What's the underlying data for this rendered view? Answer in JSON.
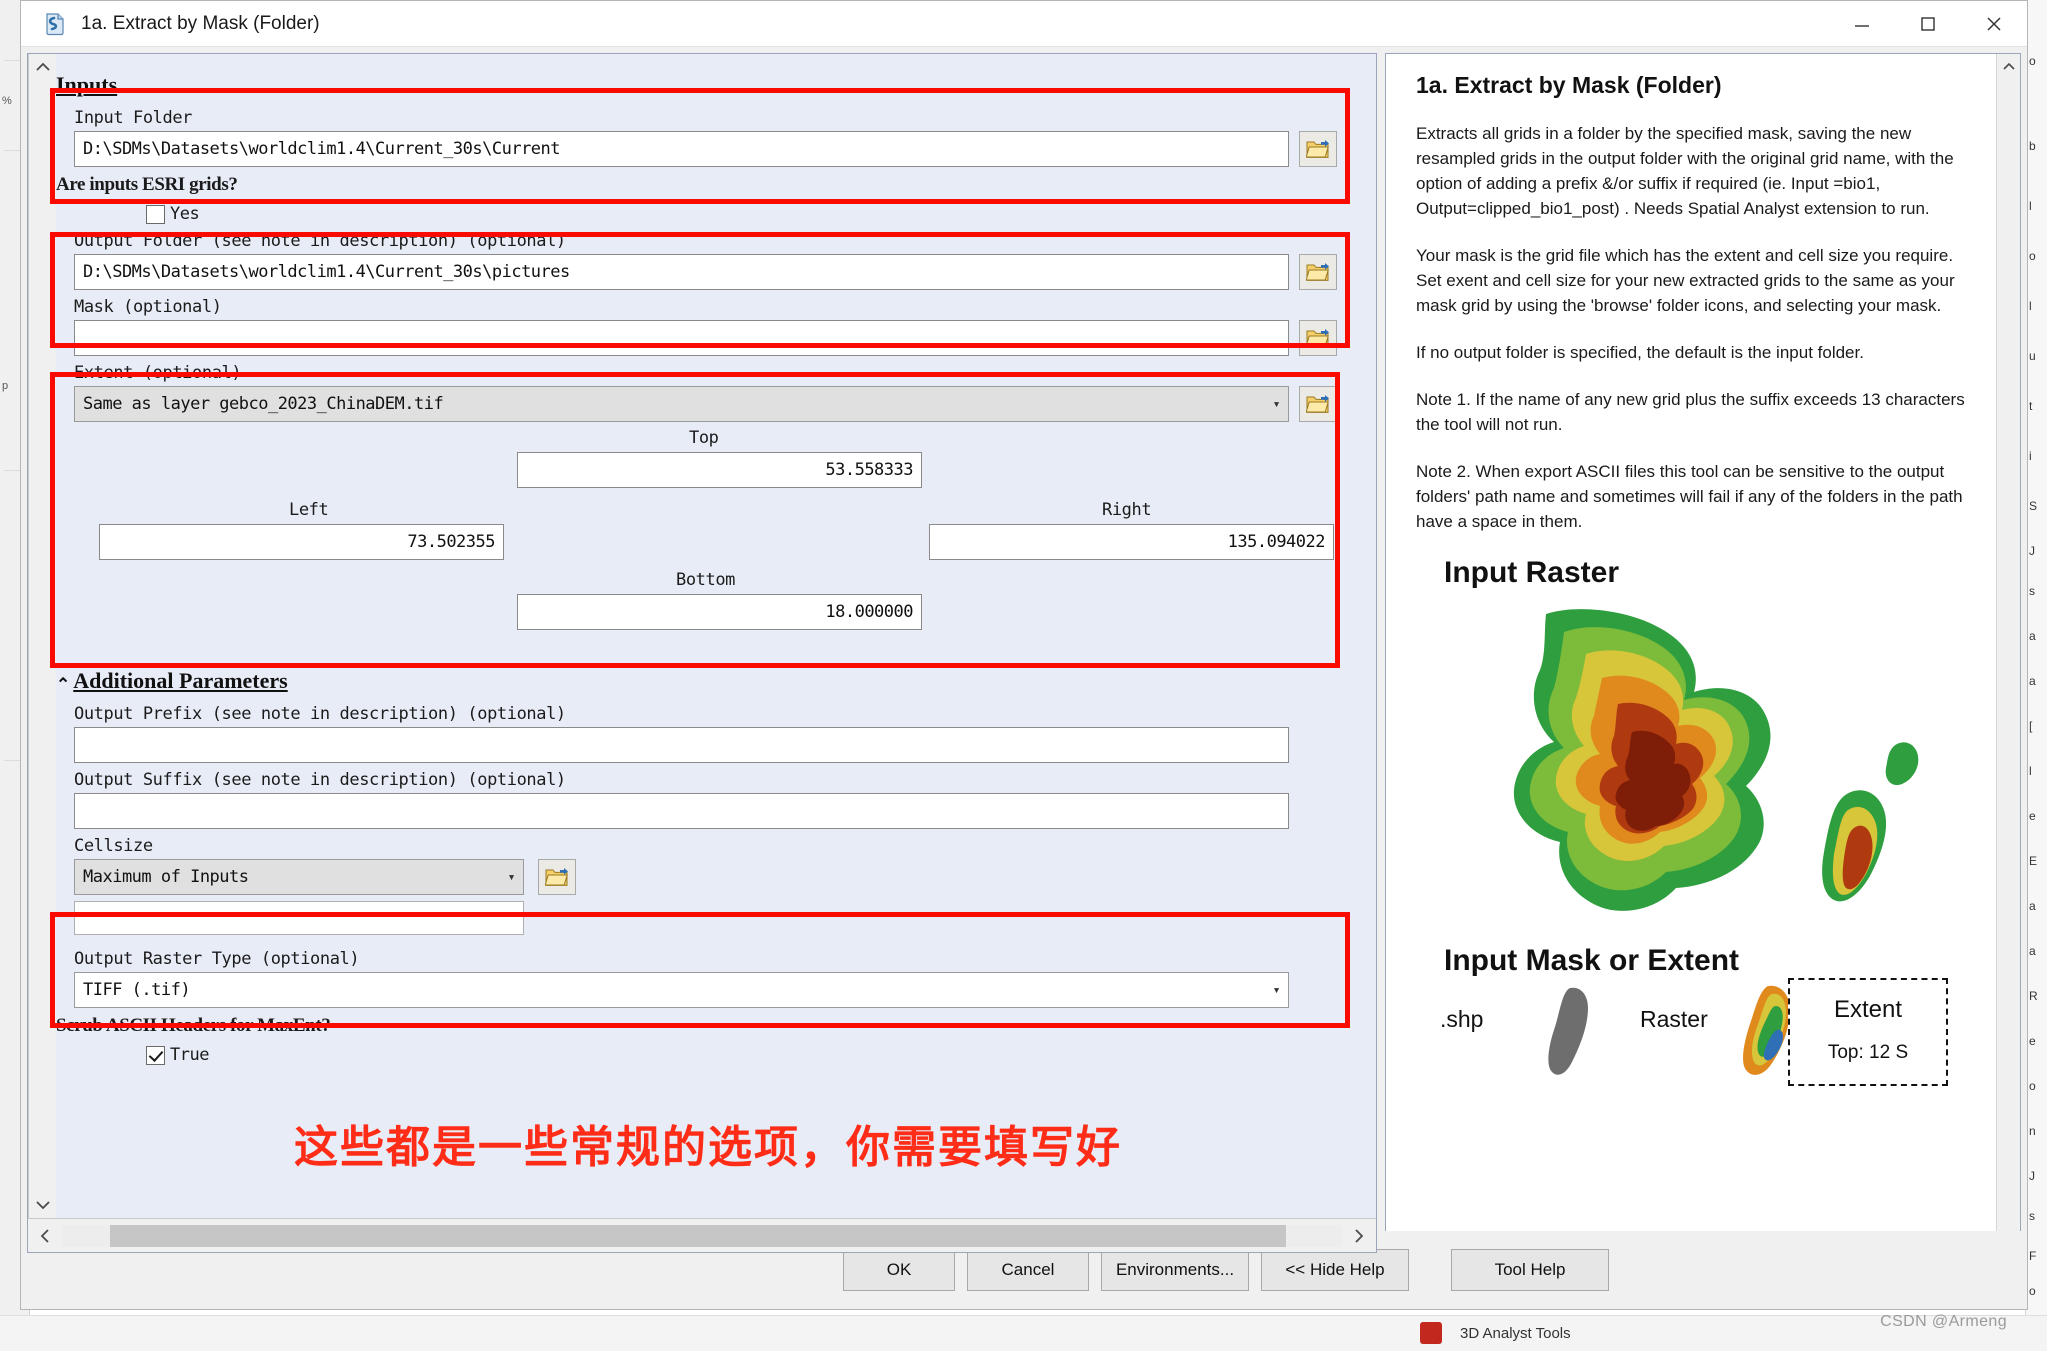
{
  "window": {
    "title": "1a. Extract by Mask (Folder)",
    "icon": "script-tool-icon",
    "minimize": "minimize-icon",
    "maximize": "maximize-icon",
    "close": "close-icon"
  },
  "params": {
    "section_inputs": "Inputs",
    "section_additional": "Additional Parameters",
    "input_folder": {
      "label": "Input Folder",
      "value": "D:\\SDMs\\Datasets\\worldclim1.4\\Current_30s\\Current",
      "browse": "browse-folder-icon"
    },
    "esri_grids": {
      "label": "Are inputs ESRI grids?",
      "checkbox_label": "Yes",
      "checked": false
    },
    "output_folder": {
      "label": "Output Folder (see note in description) (optional)",
      "value": "D:\\SDMs\\Datasets\\worldclim1.4\\Current_30s\\pictures",
      "browse": "browse-folder-icon"
    },
    "mask": {
      "label": "Mask (optional)",
      "value": "",
      "browse": "browse-folder-icon"
    },
    "extent": {
      "label": "Extent (optional)",
      "value": "Same as layer gebco_2023_ChinaDEM.tif",
      "browse": "browse-folder-icon",
      "top_label": "Top",
      "top_value": "53.558333",
      "left_label": "Left",
      "left_value": "73.502355",
      "right_label": "Right",
      "right_value": "135.094022",
      "bottom_label": "Bottom",
      "bottom_value": "18.000000"
    },
    "output_prefix": {
      "label": "Output Prefix (see note in description) (optional)",
      "value": ""
    },
    "output_suffix": {
      "label": "Output Suffix (see note in description) (optional)",
      "value": ""
    },
    "cellsize": {
      "label": "Cellsize",
      "value": "Maximum of Inputs",
      "browse": "browse-folder-icon",
      "secondary_value": ""
    },
    "output_raster_type": {
      "label": "Output Raster Type (optional)",
      "value": "TIFF (.tif)"
    },
    "scrub_ascii": {
      "label": "Scrub ASCII Headers for MaxEnt?",
      "checkbox_label": "True",
      "checked": true
    },
    "annotation_cn": "这些都是一些常规的选项，你需要填写好"
  },
  "help": {
    "title": "1a. Extract by Mask (Folder)",
    "paragraphs": [
      "Extracts all grids in a folder by the specified mask, saving the new resampled grids in the output folder with the original grid name, with the option of adding a prefix &/or suffix if required (ie. Input =bio1, Output=clipped_bio1_post) . Needs Spatial Analyst extension to run.",
      "Your mask is the grid file which has the extent and cell size you require. Set exent and cell size for your new extracted grids to the same as your mask grid by using the 'browse' folder icons, and selecting your mask.",
      "If no output folder is specified, the default is the input folder.",
      "Note 1. If the name of any new grid plus the suffix exceeds 13 characters the tool will not run.",
      "Note 2. When export ASCII files this tool can be sensitive to the output folders' path name and sometimes will fail if any of the folders in the path have a space in them."
    ],
    "graphic": {
      "caption_top": "Input Raster",
      "caption_bottom": "Input Mask or Extent",
      "mask_options": [
        ".shp",
        "Raster"
      ],
      "extent_card_title": "Extent",
      "extent_card_sub": "Top: 12 S"
    }
  },
  "buttons": {
    "ok": "OK",
    "cancel": "Cancel",
    "environments": "Environments...",
    "hide_help": "<< Hide Help",
    "tool_help": "Tool Help"
  },
  "scrollbars": {
    "left_arrow": "chevron-left-icon",
    "right_arrow": "chevron-right-icon",
    "up_arrow": "chevron-up-icon",
    "down_arrow": "chevron-down-icon"
  },
  "background": {
    "watermark": "CSDN @Armeng",
    "taskbar_label": "3D Analyst Tools",
    "right_strip": "o b l o l u t i S J s a [ l e E a a R e o n J s F o a R S"
  },
  "colors": {
    "annotation_red": "#fb0a02",
    "panel_bg": "#e8ecf7",
    "panel_border": "#9aa4bb",
    "chrome": "#f0f0f0"
  }
}
